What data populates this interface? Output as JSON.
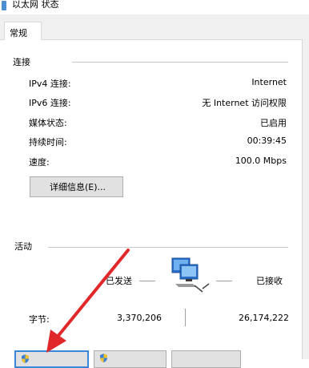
{
  "window": {
    "title": "以太网 状态",
    "icon": "network-adapter-icon"
  },
  "tabs": [
    {
      "label": "常规",
      "active": true
    }
  ],
  "connection": {
    "title": "连接",
    "rows": [
      {
        "label": "IPv4 连接:",
        "value": "Internet"
      },
      {
        "label": "IPv6 连接:",
        "value": "无 Internet 访问权限"
      },
      {
        "label": "媒体状态:",
        "value": "已启用"
      },
      {
        "label": "持续时间:",
        "value": "00:39:45"
      },
      {
        "label": "速度:",
        "value": "100.0 Mbps"
      }
    ],
    "details_button": "详细信息(E)..."
  },
  "activity": {
    "title": "活动",
    "sent_label": "已发送",
    "received_label": "已接收",
    "bytes_label": "字节:",
    "bytes_sent": "3,370,206",
    "bytes_received": "26,174,222"
  },
  "colors": {
    "annotation_arrow": "#e0282a",
    "shield_blue": "#3b7fd6",
    "shield_yellow": "#f2c230"
  }
}
